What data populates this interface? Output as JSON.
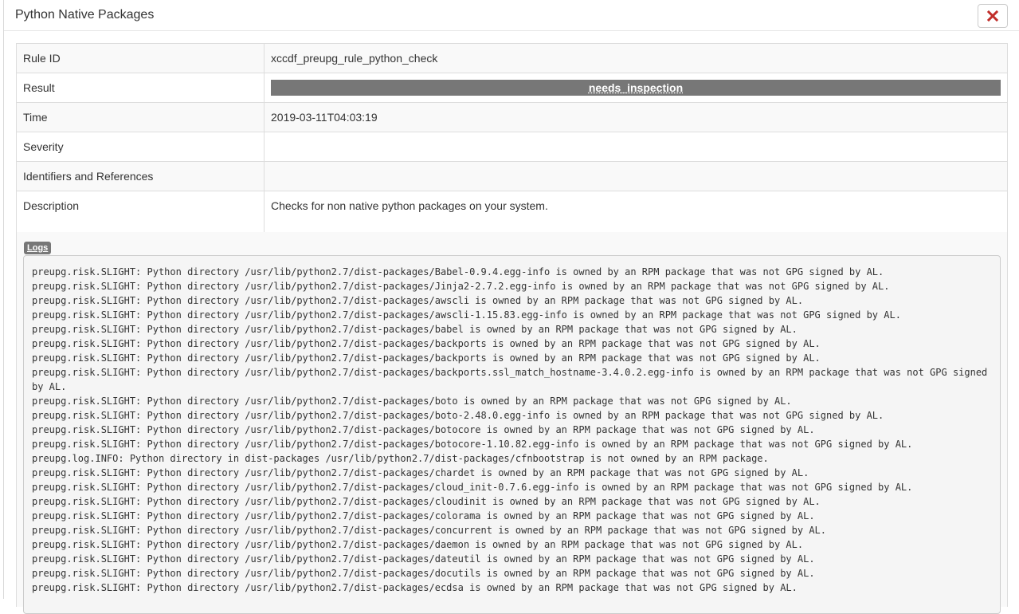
{
  "modal": {
    "title": "Python Native Packages",
    "close_icon": "close-icon"
  },
  "details": {
    "rule_id_label": "Rule ID",
    "rule_id_value": "xccdf_preupg_rule_python_check",
    "result_label": "Result",
    "result_value": "needs_inspection",
    "time_label": "Time",
    "time_value": "2019-03-11T04:03:19",
    "severity_label": "Severity",
    "severity_value": "",
    "identifiers_label": "Identifiers and References",
    "identifiers_value": "",
    "description_label": "Description",
    "description_value": "Checks for non native python packages on your system."
  },
  "logs": {
    "badge": "Logs",
    "lines": [
      "preupg.risk.SLIGHT: Python directory /usr/lib/python2.7/dist-packages/Babel-0.9.4.egg-info is owned by an RPM package that was not GPG signed by AL.",
      "preupg.risk.SLIGHT: Python directory /usr/lib/python2.7/dist-packages/Jinja2-2.7.2.egg-info is owned by an RPM package that was not GPG signed by AL.",
      "preupg.risk.SLIGHT: Python directory /usr/lib/python2.7/dist-packages/awscli is owned by an RPM package that was not GPG signed by AL.",
      "preupg.risk.SLIGHT: Python directory /usr/lib/python2.7/dist-packages/awscli-1.15.83.egg-info is owned by an RPM package that was not GPG signed by AL.",
      "preupg.risk.SLIGHT: Python directory /usr/lib/python2.7/dist-packages/babel is owned by an RPM package that was not GPG signed by AL.",
      "preupg.risk.SLIGHT: Python directory /usr/lib/python2.7/dist-packages/backports is owned by an RPM package that was not GPG signed by AL.",
      "preupg.risk.SLIGHT: Python directory /usr/lib/python2.7/dist-packages/backports is owned by an RPM package that was not GPG signed by AL.",
      "preupg.risk.SLIGHT: Python directory /usr/lib/python2.7/dist-packages/backports.ssl_match_hostname-3.4.0.2.egg-info is owned by an RPM package that was not GPG signed by AL.",
      "preupg.risk.SLIGHT: Python directory /usr/lib/python2.7/dist-packages/boto is owned by an RPM package that was not GPG signed by AL.",
      "preupg.risk.SLIGHT: Python directory /usr/lib/python2.7/dist-packages/boto-2.48.0.egg-info is owned by an RPM package that was not GPG signed by AL.",
      "preupg.risk.SLIGHT: Python directory /usr/lib/python2.7/dist-packages/botocore is owned by an RPM package that was not GPG signed by AL.",
      "preupg.risk.SLIGHT: Python directory /usr/lib/python2.7/dist-packages/botocore-1.10.82.egg-info is owned by an RPM package that was not GPG signed by AL.",
      "preupg.log.INFO: Python directory in dist-packages /usr/lib/python2.7/dist-packages/cfnbootstrap is not owned by an RPM package.",
      "preupg.risk.SLIGHT: Python directory /usr/lib/python2.7/dist-packages/chardet is owned by an RPM package that was not GPG signed by AL.",
      "preupg.risk.SLIGHT: Python directory /usr/lib/python2.7/dist-packages/cloud_init-0.7.6.egg-info is owned by an RPM package that was not GPG signed by AL.",
      "preupg.risk.SLIGHT: Python directory /usr/lib/python2.7/dist-packages/cloudinit is owned by an RPM package that was not GPG signed by AL.",
      "preupg.risk.SLIGHT: Python directory /usr/lib/python2.7/dist-packages/colorama is owned by an RPM package that was not GPG signed by AL.",
      "preupg.risk.SLIGHT: Python directory /usr/lib/python2.7/dist-packages/concurrent is owned by an RPM package that was not GPG signed by AL.",
      "preupg.risk.SLIGHT: Python directory /usr/lib/python2.7/dist-packages/daemon is owned by an RPM package that was not GPG signed by AL.",
      "preupg.risk.SLIGHT: Python directory /usr/lib/python2.7/dist-packages/dateutil is owned by an RPM package that was not GPG signed by AL.",
      "preupg.risk.SLIGHT: Python directory /usr/lib/python2.7/dist-packages/docutils is owned by an RPM package that was not GPG signed by AL.",
      "preupg.risk.SLIGHT: Python directory /usr/lib/python2.7/dist-packages/ecdsa is owned by an RPM package that was not GPG signed by AL."
    ]
  },
  "colors": {
    "badge_gray": "#777777",
    "close_red": "#c12e2a",
    "row_stripe": "#f9f9f9",
    "pre_bg": "#f5f5f5"
  }
}
